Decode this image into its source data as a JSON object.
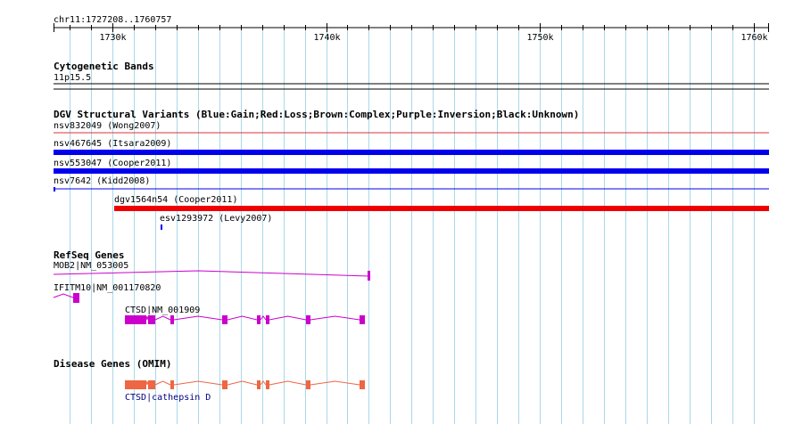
{
  "header": {
    "position_label": "chr11:1727208..1760757"
  },
  "ruler": {
    "ticks": [
      {
        "label": "1730k",
        "value": 1730000
      },
      {
        "label": "1740k",
        "value": 1740000
      },
      {
        "label": "1750k",
        "value": 1750000
      },
      {
        "label": "1760k",
        "value": 1760000
      }
    ]
  },
  "tracks": {
    "cytoband": {
      "title": "Cytogenetic Bands",
      "band_label": "11p15.5"
    },
    "dgv": {
      "title": "DGV Structural Variants (Blue:Gain;Red:Loss;Brown:Complex;Purple:Inversion;Black:Unknown)",
      "features": [
        {
          "label": "nsv832049 (Wong2007)",
          "type": "Loss",
          "color": "#dd3333",
          "style": "thin"
        },
        {
          "label": "nsv467645 (Itsara2009)",
          "type": "Gain",
          "color": "#0000ee",
          "style": "thick"
        },
        {
          "label": "nsv553047 (Cooper2011)",
          "type": "Gain",
          "color": "#0000ee",
          "style": "thick"
        },
        {
          "label": "nsv7642 (Kidd2008)",
          "type": "Gain",
          "color": "#0000ee",
          "style": "thin"
        },
        {
          "label": "dgv1564n54 (Cooper2011)",
          "type": "Loss",
          "color": "#ee0000",
          "style": "thick"
        },
        {
          "label": "esv1293972 (Levy2007)",
          "type": "Gain",
          "color": "#0000ee",
          "style": "tick"
        }
      ]
    },
    "refseq": {
      "title": "RefSeq Genes",
      "genes": [
        {
          "label": "MOB2|NM_053005",
          "color": "#cc00cc"
        },
        {
          "label": "IFITM10|NM_001170820",
          "color": "#cc00cc"
        },
        {
          "label": "CTSD|NM_001909",
          "color": "#cc00cc"
        }
      ]
    },
    "omim": {
      "title": "Disease Genes (OMIM)",
      "genes": [
        {
          "label": "CTSD|cathepsin D",
          "color": "#ee6644",
          "label_color": "#000080"
        }
      ]
    }
  },
  "grid_color": "#a9d8ea"
}
